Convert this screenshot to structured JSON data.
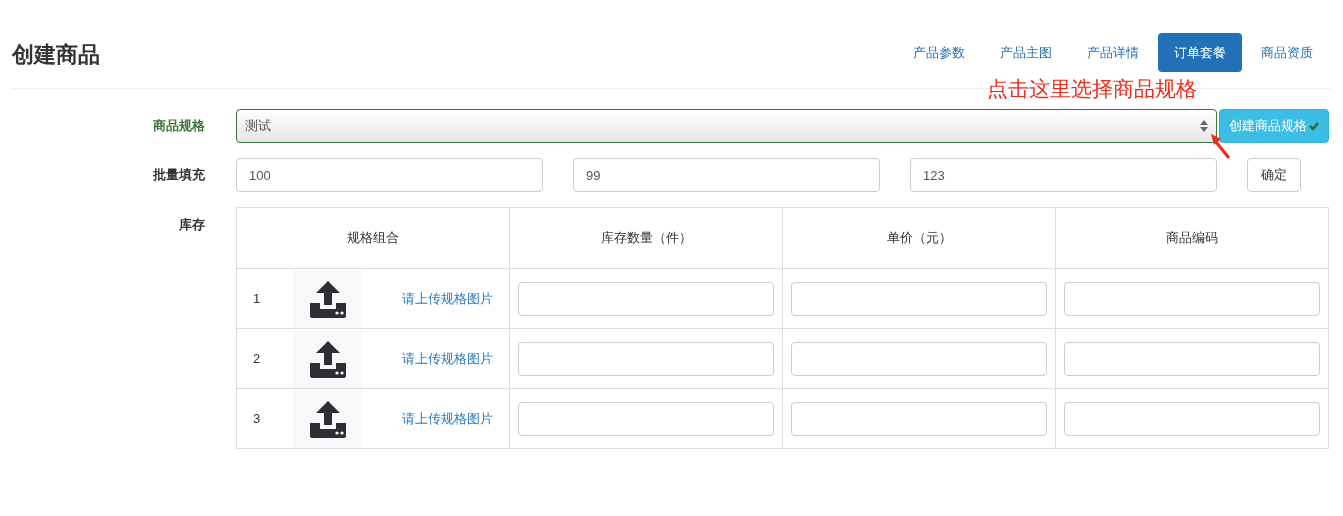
{
  "page_title": "创建商品",
  "tabs": [
    {
      "label": "产品参数",
      "selected": false
    },
    {
      "label": "产品主图",
      "selected": false
    },
    {
      "label": "产品详情",
      "selected": false
    },
    {
      "label": "订单套餐",
      "selected": true
    },
    {
      "label": "商品资质",
      "selected": false
    }
  ],
  "annotation": "点击这里选择商品规格",
  "spec": {
    "label": "商品规格",
    "value": "测试",
    "valid": true,
    "create_button": "创建商品规格"
  },
  "batch": {
    "label": "批量填充",
    "values": [
      "100",
      "99",
      "123"
    ],
    "confirm_button": "确定"
  },
  "stock": {
    "label": "库存",
    "columns": [
      "规格组合",
      "库存数量（件）",
      "单价（元）",
      "商品编码"
    ],
    "rows": [
      {
        "index": "1",
        "upload_link": "请上传规格图片"
      },
      {
        "index": "2",
        "upload_link": "请上传规格图片"
      },
      {
        "index": "3",
        "upload_link": "请上传规格图片"
      }
    ]
  }
}
